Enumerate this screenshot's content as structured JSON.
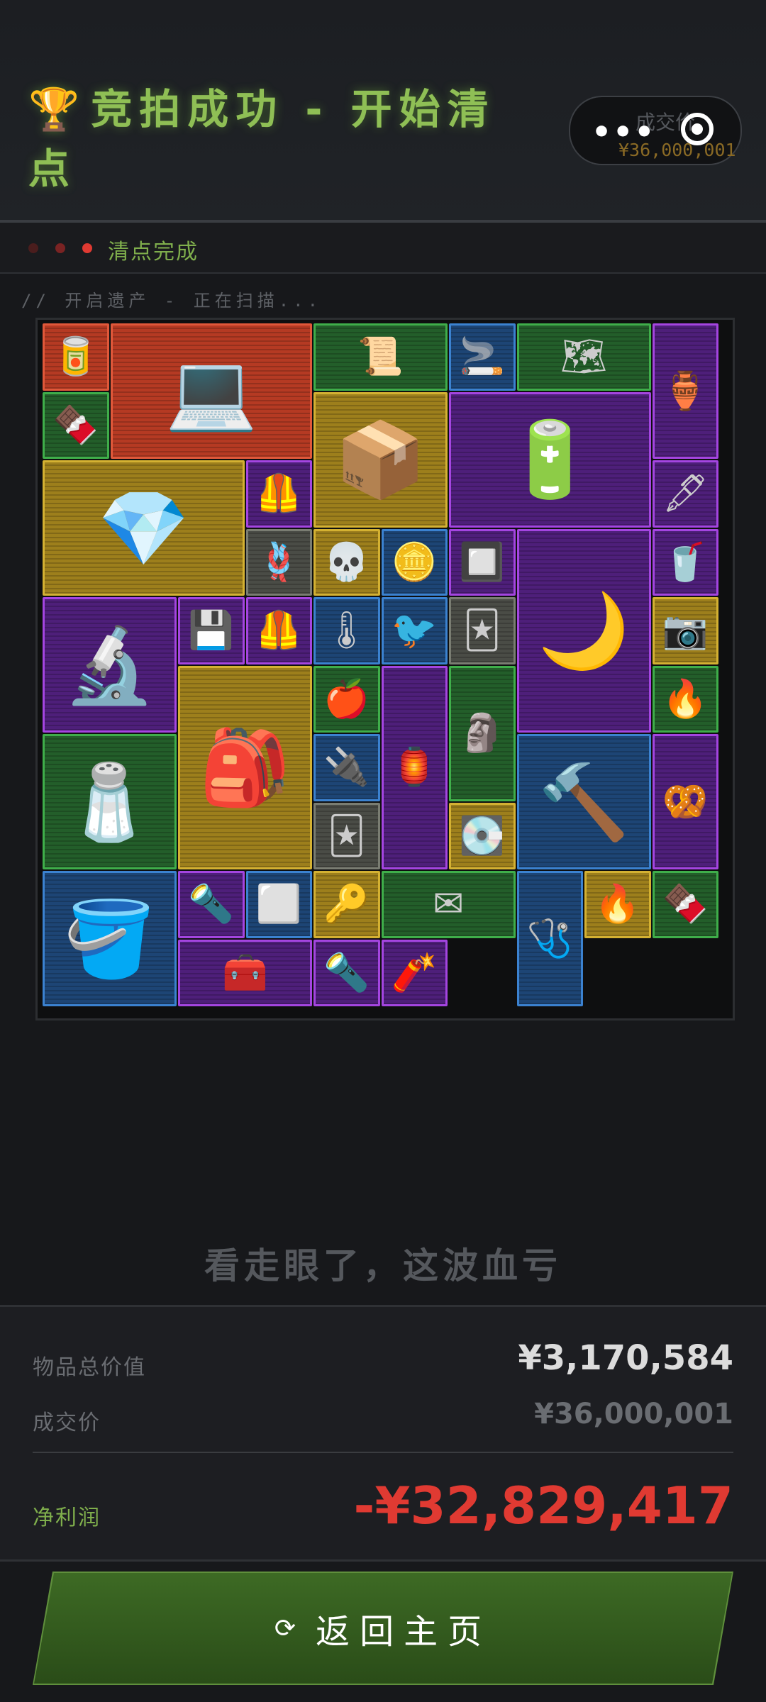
{
  "header": {
    "trophy_icon": "🏆",
    "title": "竞拍成功 - 开始清点",
    "price_label": "成交价",
    "price_value": "¥36,000,001",
    "title_color": "#8fbf55"
  },
  "progress": {
    "dot_colors": [
      "#4a1d1d",
      "#7a2323",
      "#e03a32"
    ],
    "label": "清点完成"
  },
  "scan_status": "// 开启遗产 - 正在扫描...",
  "items": [
    {
      "name": "caviar-tin",
      "rarity": "red",
      "icon": "🥫"
    },
    {
      "name": "rugged-laptop-case",
      "rarity": "red",
      "icon": "💻"
    },
    {
      "name": "old-parchment",
      "rarity": "green",
      "icon": "📜"
    },
    {
      "name": "cigarette-pack",
      "rarity": "blue",
      "icon": "🚬"
    },
    {
      "name": "blueprint-map",
      "rarity": "green",
      "icon": "🗺"
    },
    {
      "name": "brass-hookah",
      "rarity": "purple",
      "icon": "🏺"
    },
    {
      "name": "chocolate-bar",
      "rarity": "green",
      "icon": "🍫"
    },
    {
      "name": "supply-crate",
      "rarity": "yellow",
      "icon": "📦"
    },
    {
      "name": "car-battery",
      "rarity": "purple",
      "icon": "🔋"
    },
    {
      "name": "jeweled-keychain",
      "rarity": "yellow",
      "icon": "💎"
    },
    {
      "name": "body-armor-plate",
      "rarity": "purple",
      "icon": "🦺"
    },
    {
      "name": "fountain-pen",
      "rarity": "purple",
      "icon": "🖋"
    },
    {
      "name": "rope-coil",
      "rarity": "gray",
      "icon": "🪢"
    },
    {
      "name": "skull-pendant",
      "rarity": "yellow",
      "icon": "💀"
    },
    {
      "name": "ancient-coin",
      "rarity": "blue",
      "icon": "🪙"
    },
    {
      "name": "circuit-chip",
      "rarity": "purple",
      "icon": "🔲"
    },
    {
      "name": "crescent-lamp",
      "rarity": "purple",
      "icon": "🌙"
    },
    {
      "name": "energy-drink",
      "rarity": "purple",
      "icon": "🥤"
    },
    {
      "name": "lab-centrifuge",
      "rarity": "purple",
      "icon": "🔬"
    },
    {
      "name": "ssd-drive",
      "rarity": "purple",
      "icon": "💾"
    },
    {
      "name": "vest-insert",
      "rarity": "purple",
      "icon": "🦺"
    },
    {
      "name": "thermometer-gun",
      "rarity": "blue",
      "icon": "🌡"
    },
    {
      "name": "wooden-bird",
      "rarity": "blue",
      "icon": "🐦"
    },
    {
      "name": "playing-card",
      "rarity": "gray",
      "icon": "🃏"
    },
    {
      "name": "camera-lens",
      "rarity": "yellow",
      "icon": "📷"
    },
    {
      "name": "heavy-case",
      "rarity": "yellow",
      "icon": "🎒"
    },
    {
      "name": "red-apple",
      "rarity": "green",
      "icon": "🍎"
    },
    {
      "name": "lantern",
      "rarity": "purple",
      "icon": "🏮"
    },
    {
      "name": "carved-mask",
      "rarity": "green",
      "icon": "🗿"
    },
    {
      "name": "lighter",
      "rarity": "green",
      "icon": "🔥"
    },
    {
      "name": "spice-rack",
      "rarity": "green",
      "icon": "🧂"
    },
    {
      "name": "usb-stick",
      "rarity": "blue",
      "icon": "🔌"
    },
    {
      "name": "rotary-hammer",
      "rarity": "blue",
      "icon": "🔨"
    },
    {
      "name": "snack-pack",
      "rarity": "purple",
      "icon": "🥨"
    },
    {
      "name": "club-card",
      "rarity": "gray",
      "icon": "🃏"
    },
    {
      "name": "hard-drive",
      "rarity": "yellow",
      "icon": "💽"
    },
    {
      "name": "paint-bucket",
      "rarity": "blue",
      "icon": "🪣"
    },
    {
      "name": "flashlight-tube",
      "rarity": "purple",
      "icon": "🔦"
    },
    {
      "name": "metal-sheet",
      "rarity": "blue",
      "icon": "⬜"
    },
    {
      "name": "gold-key",
      "rarity": "yellow",
      "icon": "🔑"
    },
    {
      "name": "old-letter",
      "rarity": "green",
      "icon": "✉"
    },
    {
      "name": "stethoscope",
      "rarity": "blue",
      "icon": "🩺"
    },
    {
      "name": "zippo-lighter",
      "rarity": "yellow",
      "icon": "🔥"
    },
    {
      "name": "candy-bar",
      "rarity": "green",
      "icon": "🍫"
    },
    {
      "name": "tool-kit",
      "rarity": "purple",
      "icon": "🧰"
    },
    {
      "name": "flashlight",
      "rarity": "purple",
      "icon": "🔦"
    },
    {
      "name": "glow-stick",
      "rarity": "purple",
      "icon": "🧨"
    }
  ],
  "verdict": "看走眼了，这波血亏",
  "summary": {
    "total_label": "物品总价值",
    "total_value": "¥3,170,584",
    "deal_label": "成交价",
    "deal_value": "¥36,000,001",
    "profit_label": "净利润",
    "profit_value": "-¥32,829,417",
    "profit_color": "#e03a32"
  },
  "home_button": {
    "icon": "⟳",
    "label": "返回主页"
  }
}
